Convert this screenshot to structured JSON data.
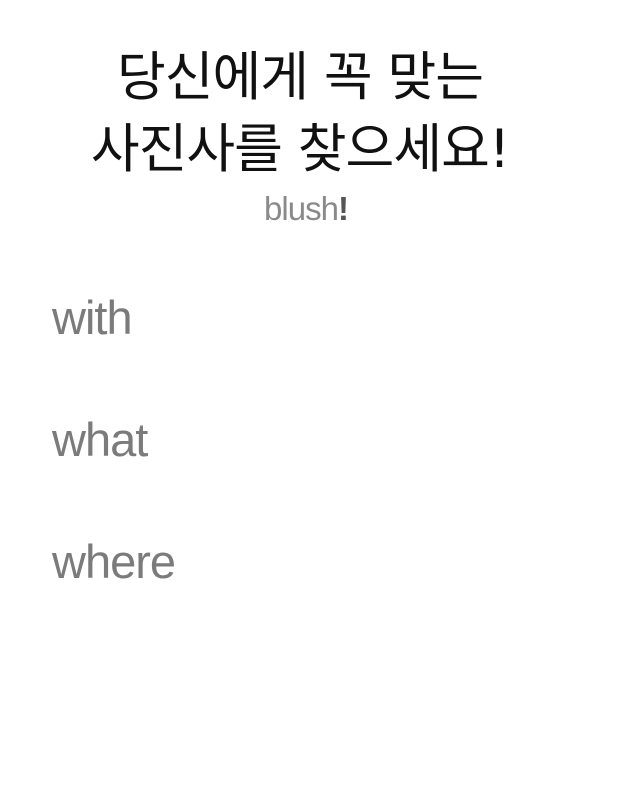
{
  "headline": {
    "line1": "당신에게 꼭 맞는",
    "line2": "사진사를 찾으세요!"
  },
  "brand": {
    "name": "blush",
    "mark": "!"
  },
  "options": [
    {
      "label": "with"
    },
    {
      "label": "what"
    },
    {
      "label": "where"
    }
  ],
  "colors": {
    "headline": "#111111",
    "brand": "#8a8a8a",
    "options": "#7b7b7b",
    "background": "#ffffff"
  }
}
